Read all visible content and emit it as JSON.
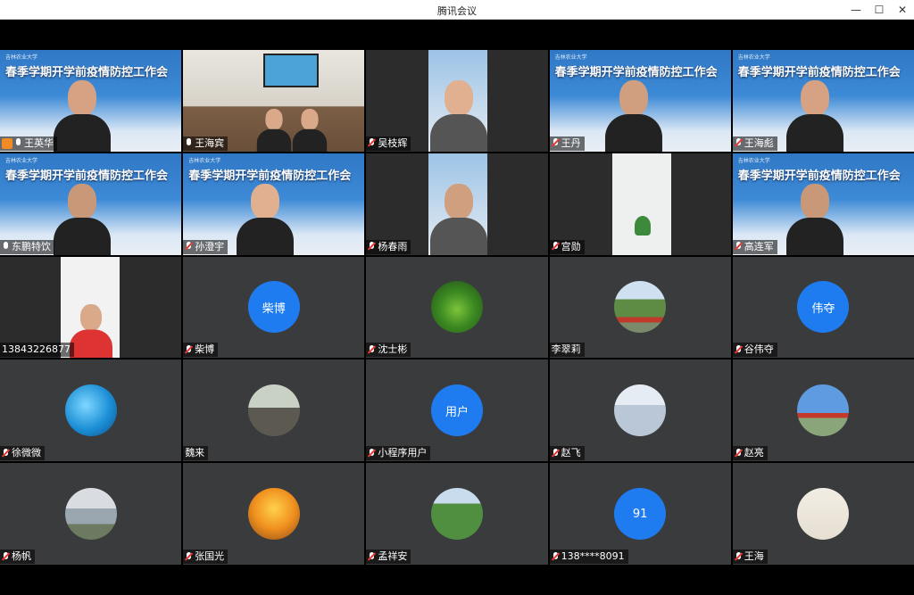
{
  "window": {
    "title": "腾讯会议",
    "minimize": "—",
    "maximize": "☐",
    "close": "✕"
  },
  "banner_text": "春季学期开学前疫情防控工作会",
  "banner_school": "吉林农业大学",
  "tiles": [
    {
      "name": "王英华",
      "type": "banner",
      "mic": "on",
      "host": true
    },
    {
      "name": "王海宾",
      "type": "room",
      "mic": "on"
    },
    {
      "name": "吴枝辉",
      "type": "sidevideo",
      "mic": "muted"
    },
    {
      "name": "王丹",
      "type": "banner",
      "mic": "muted"
    },
    {
      "name": "王海彪",
      "type": "banner",
      "mic": "muted"
    },
    {
      "name": "东鹏特饮",
      "type": "banner",
      "mic": "on"
    },
    {
      "name": "孙澄宇",
      "type": "banner",
      "mic": "muted"
    },
    {
      "name": "杨春雨",
      "type": "sidevideo",
      "mic": "muted"
    },
    {
      "name": "宫勋",
      "type": "white",
      "mic": "muted"
    },
    {
      "name": "高连军",
      "type": "banner",
      "mic": "muted"
    },
    {
      "name": "13843226877",
      "type": "phone",
      "mic": "none"
    },
    {
      "name": "柴博",
      "type": "avatar",
      "avatar_text": "柴博",
      "avatar_color": "#1f7cf0",
      "mic": "muted"
    },
    {
      "name": "沈士彬",
      "type": "avatar",
      "avatar_icon": "leaf-photo",
      "avatar_color": "#2f8a2c",
      "mic": "muted"
    },
    {
      "name": "李翠莉",
      "type": "avatar",
      "avatar_icon": "park-photo",
      "avatar_color": "#6a8a4a",
      "mic": "none"
    },
    {
      "name": "谷伟夺",
      "type": "avatar",
      "avatar_text": "伟夺",
      "avatar_color": "#1f7cf0",
      "mic": "muted"
    },
    {
      "name": "徐微微",
      "type": "avatar",
      "avatar_icon": "ocean-photo",
      "avatar_color": "#1f8fd0",
      "mic": "muted"
    },
    {
      "name": "魏来",
      "type": "avatar",
      "avatar_icon": "person-photo",
      "avatar_color": "#8a8f7a",
      "mic": "none"
    },
    {
      "name": "小程序用户",
      "type": "avatar",
      "avatar_text": "用户",
      "avatar_color": "#1f7cf0",
      "mic": "muted"
    },
    {
      "name": "赵飞",
      "type": "avatar",
      "avatar_icon": "ice-photo",
      "avatar_color": "#a8b6c4",
      "mic": "muted"
    },
    {
      "name": "赵亮",
      "type": "avatar",
      "avatar_icon": "sky-photo",
      "avatar_color": "#4d86c8",
      "mic": "muted"
    },
    {
      "name": "杨帆",
      "type": "avatar",
      "avatar_icon": "river-photo",
      "avatar_color": "#9aa6b0",
      "mic": "muted"
    },
    {
      "name": "张国光",
      "type": "avatar",
      "avatar_icon": "autumn-photo",
      "avatar_color": "#e89a2a",
      "mic": "muted"
    },
    {
      "name": "孟祥安",
      "type": "avatar",
      "avatar_icon": "field-photo",
      "avatar_color": "#3f7a36",
      "mic": "muted"
    },
    {
      "name": "138****8091",
      "type": "avatar",
      "avatar_text": "91",
      "avatar_color": "#1f7cf0",
      "mic": "muted"
    },
    {
      "name": "王海",
      "type": "avatar",
      "avatar_icon": "fish-photo",
      "avatar_color": "#efe8dc",
      "mic": "muted"
    }
  ]
}
